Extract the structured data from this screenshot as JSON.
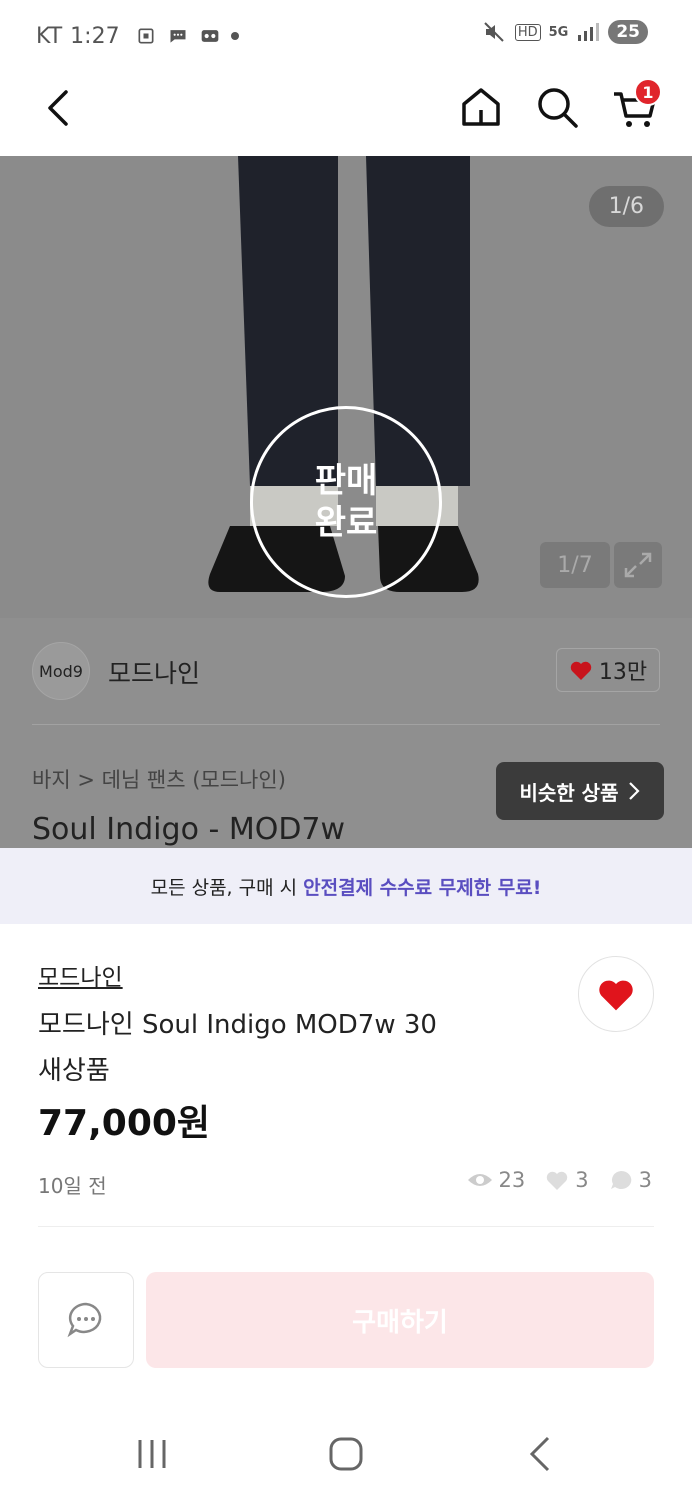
{
  "status_bar": {
    "carrier": "KT",
    "time": "1:27",
    "network": "5G",
    "hd": "HD",
    "battery": "25"
  },
  "nav": {
    "cart_count": "1"
  },
  "gallery": {
    "counter_top": "1/6",
    "counter_inner": "1/7",
    "sold_line1": "판매",
    "sold_line2": "완료"
  },
  "shop": {
    "logo_text": "Mod9",
    "name": "모드나인",
    "likes": "13만"
  },
  "breadcrumb": "바지 > 데님 팬츠 (모드나인)",
  "similar_button": "비슷한 상품",
  "background_title": "Soul Indigo - MOD7w",
  "banner": {
    "text": "모든 상품, 구매 시",
    "highlight": "안전결제 수수료 무제한 무료!"
  },
  "product": {
    "shop_link": "모드나인",
    "title": "모드나인 Soul Indigo MOD7w 30",
    "condition": "새상품",
    "price": "77,000원",
    "posted": "10일 전",
    "views": "23",
    "likes": "3",
    "chats": "3"
  },
  "actions": {
    "buy_label": "구매하기"
  },
  "colors": {
    "accent_red": "#e0252b",
    "highlight_purple": "#5a4ec0",
    "buy_disabled": "#fce6e8"
  }
}
